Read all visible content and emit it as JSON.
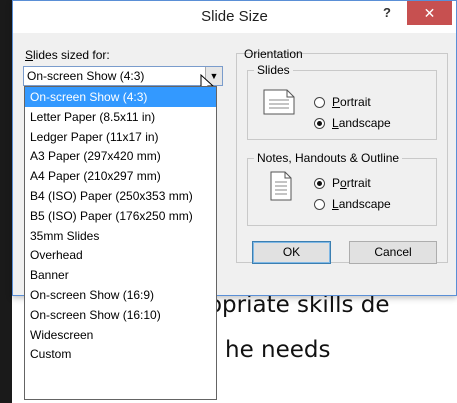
{
  "background": {
    "line1": "ropriate skills de",
    "line2": "he needs"
  },
  "dialog": {
    "title": "Slide Size",
    "help_label": "?",
    "close_label": "✕",
    "slides_sized_for_label": "Slides sized for:",
    "selected_size": "On-screen Show (4:3)",
    "ok_label": "OK",
    "cancel_label": "Cancel"
  },
  "orientation": {
    "group_label": "Orientation",
    "slides": {
      "group_label": "Slides",
      "portrait_label": "Portrait",
      "landscape_label": "Landscape",
      "selected": "landscape"
    },
    "notes": {
      "group_label": "Notes, Handouts & Outline",
      "portrait_label": "Portrait",
      "landscape_label": "Landscape",
      "selected": "portrait"
    }
  },
  "dropdown": {
    "options": [
      "On-screen Show (4:3)",
      "Letter Paper (8.5x11 in)",
      "Ledger Paper (11x17 in)",
      "A3 Paper (297x420 mm)",
      "A4 Paper (210x297 mm)",
      "B4 (ISO) Paper (250x353 mm)",
      "B5 (ISO) Paper (176x250 mm)",
      "35mm Slides",
      "Overhead",
      "Banner",
      "On-screen Show (16:9)",
      "On-screen Show (16:10)",
      "Widescreen",
      "Custom"
    ],
    "highlighted_index": 0
  },
  "colors": {
    "highlight": "#3399ff",
    "close_button": "#c75050",
    "dialog_bg": "#f0f0f0"
  }
}
